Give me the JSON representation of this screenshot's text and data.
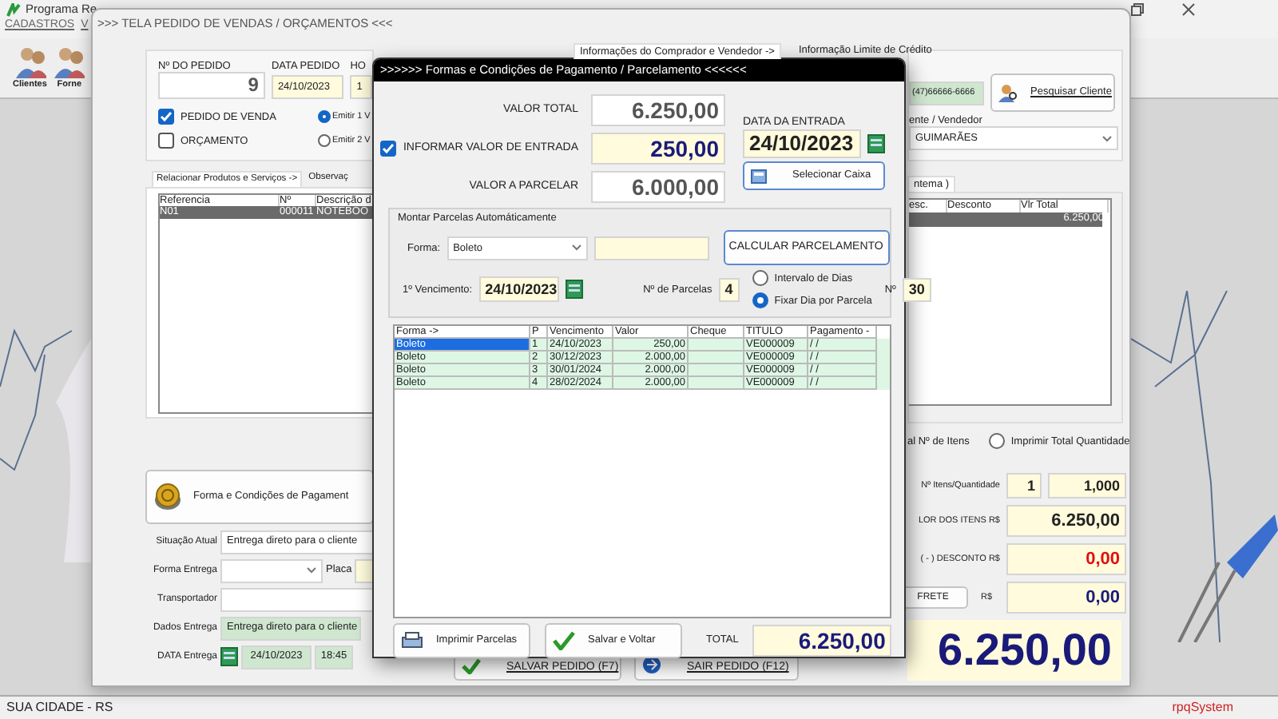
{
  "app": {
    "title": "Programa Re",
    "menu": [
      "CADASTROS",
      "V"
    ],
    "toolbar": [
      "Clientes",
      "Forne"
    ],
    "status_bar": [
      "SUA CIDADE - RS",
      "rpqSystem"
    ]
  },
  "order_window": {
    "title": ">>>   TELA PEDIDO DE VENDAS / ORÇAMENTOS   <<<",
    "order_number": {
      "label": "Nº DO PEDIDO",
      "value": "9"
    },
    "order_date": {
      "label": "DATA PEDIDO",
      "value": "24/10/2023"
    },
    "order_time": {
      "label": "HO",
      "value": "1"
    },
    "doc_types": [
      {
        "label": "PEDIDO DE VENDA",
        "checked": true
      },
      {
        "label": "ORÇAMENTO",
        "checked": false
      }
    ],
    "copies": [
      {
        "label": "Emitir 1 V",
        "selected": true
      },
      {
        "label": "Emitir 2 V",
        "selected": false
      }
    ],
    "tabs": [
      {
        "label": "Relacionar Produtos e Serviços ->",
        "selected": true
      },
      {
        "label": "Observaç",
        "selected": false
      }
    ],
    "items_table": {
      "columns": [
        "Referencia",
        "Nº",
        "Descrição d"
      ],
      "rows": [
        {
          "cells": [
            "N01",
            "000011",
            "NOTEBOO"
          ],
          "selected": true
        }
      ]
    },
    "payment_button": "Forma e Condições de Pagament",
    "delivery": {
      "situation": {
        "label": "Situação Atual",
        "value": "Entrega direto para o cliente"
      },
      "method": {
        "label": "Forma Entrega"
      },
      "plate": {
        "label": "Placa"
      },
      "carrier": {
        "label": "Transportador"
      },
      "data": {
        "label": "Dados Entrega",
        "value": "Entrega direto para o cliente"
      },
      "date": {
        "label": "DATA Entrega",
        "value": "24/10/2023",
        "time": "18:45"
      }
    },
    "buttons": [
      "SALVAR PEDIDO (F7)",
      "SAIR PEDIDO (F12)"
    ],
    "info_tabs": [
      {
        "label": "Informações do Comprador e Vendedor ->",
        "selected": true
      },
      {
        "label": "Informação Limite de Crédito",
        "selected": false
      }
    ],
    "phone": "(47)66666-6666",
    "search_client_button": "Pesquisar Cliente",
    "seller": {
      "label": "ente / Vendedor",
      "value": "GUIMARÃES"
    },
    "right_tab": "ntema )",
    "totals_table": {
      "columns": [
        "esc.",
        "Desconto",
        "Vlr Total"
      ],
      "rows": [
        {
          "vlr_total": "6.250,00"
        }
      ]
    },
    "print_options": {
      "cut_label": "al Nº de Itens",
      "radio": {
        "label": "Imprimir Total Quantidade",
        "selected": false
      }
    },
    "summary": {
      "qty_label": "Nº Itens/Quantidade",
      "items": "1",
      "quantity": "1,000",
      "items_value_label": "LOR DOS ITENS R$",
      "items_value": "6.250,00",
      "discount_label": "( - ) DESCONTO R$",
      "discount": "0,00",
      "freight_button": "FRETE",
      "freight_label": "R$",
      "freight": "0,00",
      "grand_total": "6.250,00"
    }
  },
  "payment_dialog": {
    "title": ">>>>>> Formas e Condições de Pagamento / Parcelamento <<<<<<",
    "total": {
      "label": "VALOR TOTAL",
      "value": "6.250,00"
    },
    "down_payment": {
      "label": "INFORMAR VALOR DE ENTRADA",
      "checked": true,
      "value": "250,00"
    },
    "to_split": {
      "label": "VALOR A PARCELAR",
      "value": "6.000,00"
    },
    "entry_date": {
      "label": "DATA DA ENTRADA",
      "value": "24/10/2023"
    },
    "select_cashier_button": "Selecionar Caixa",
    "auto_group": {
      "title": "Montar Parcelas Automáticamente",
      "method_label": "Forma:",
      "method": "Boleto",
      "calculate_button": "CALCULAR PARCELAMENTO",
      "first_due_label": "1º Vencimento:",
      "first_due": "24/10/2023",
      "count_label": "Nº de Parcelas",
      "count": "4",
      "modes": [
        {
          "label": "Intervalo de Dias",
          "selected": false
        },
        {
          "label": "Fixar Dia por Parcela",
          "selected": true
        }
      ],
      "day_label": "Nº",
      "day": "30"
    },
    "grid": {
      "columns": [
        "Forma ->",
        "P",
        "Vencimento",
        "Valor",
        "Cheque",
        "TITULO",
        "Pagamento -"
      ],
      "rows": [
        {
          "forma": "Boleto",
          "p": "1",
          "vencimento": "24/10/2023",
          "valor": "250,00",
          "titulo": "VE000009",
          "pagamento": " /  /",
          "selected": true
        },
        {
          "forma": "Boleto",
          "p": "2",
          "vencimento": "30/12/2023",
          "valor": "2.000,00",
          "titulo": "VE000009",
          "pagamento": " /  /",
          "selected": false
        },
        {
          "forma": "Boleto",
          "p": "3",
          "vencimento": "30/01/2024",
          "valor": "2.000,00",
          "titulo": "VE000009",
          "pagamento": " /  /",
          "selected": false
        },
        {
          "forma": "Boleto",
          "p": "4",
          "vencimento": "28/02/2024",
          "valor": "2.000,00",
          "titulo": "VE000009",
          "pagamento": " /  /",
          "selected": false
        }
      ]
    },
    "print_button": "Imprimir Parcelas",
    "save_button": "Salvar e Voltar",
    "total_label": "TOTAL",
    "total_value": "6.250,00"
  }
}
